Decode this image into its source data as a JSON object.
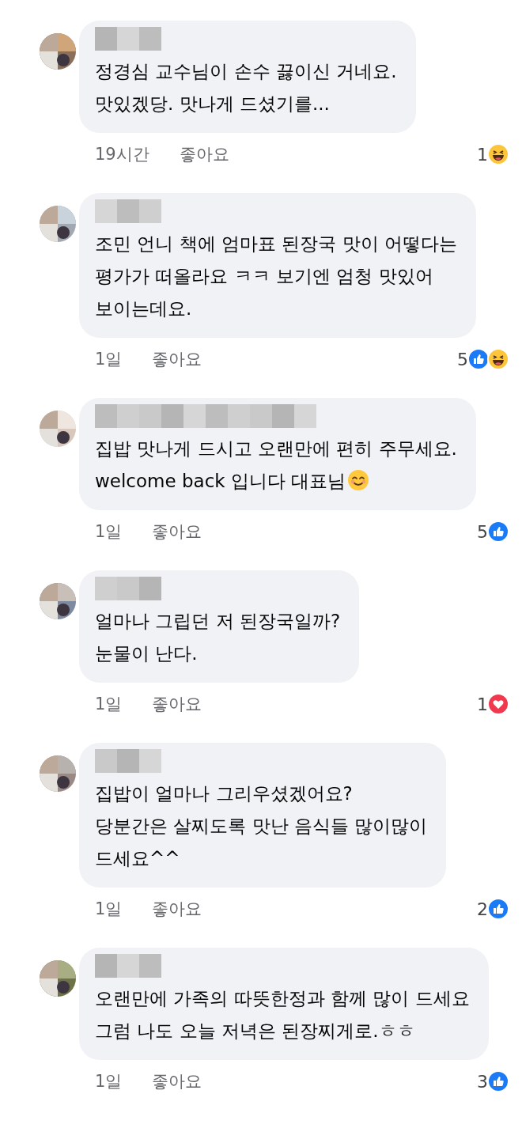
{
  "comments": [
    {
      "name_long": false,
      "text": "정경심 교수님이 손수 끓이신 거네요.\n맛있겠당. 맛나게 드셨기를...",
      "ends_with_emoji": false,
      "time": "19시간",
      "like_label": "좋아요",
      "reaction_count": "1",
      "reactions": [
        {
          "kind": "haha"
        }
      ]
    },
    {
      "name_long": false,
      "text": "조민 언니  책에  엄마표  된장국 맛이 어떻다는\n평가가 떠올라요 ㅋㅋ 보기엔  엄청 맛있어\n보이는데요.",
      "ends_with_emoji": false,
      "time": "1일",
      "like_label": "좋아요",
      "reaction_count": "5",
      "reactions": [
        {
          "kind": "like"
        },
        {
          "kind": "haha"
        }
      ]
    },
    {
      "name_long": true,
      "text": "집밥 맛나게 드시고 오랜만에 편히 주무세요.\nwelcome back 입니다 대표님",
      "ends_with_emoji": true,
      "time": "1일",
      "like_label": "좋아요",
      "reaction_count": "5",
      "reactions": [
        {
          "kind": "like"
        }
      ]
    },
    {
      "name_long": false,
      "text": "얼마나 그립던 저 된장국일까?\n눈물이 난다.",
      "ends_with_emoji": false,
      "time": "1일",
      "like_label": "좋아요",
      "reaction_count": "1",
      "reactions": [
        {
          "kind": "love"
        }
      ]
    },
    {
      "name_long": false,
      "text": "집밥이 얼마나 그리우셨겠어요?\n당분간은 살찌도록 맛난 음식들 많이많이\n드세요^^",
      "ends_with_emoji": false,
      "time": "1일",
      "like_label": "좋아요",
      "reaction_count": "2",
      "reactions": [
        {
          "kind": "like"
        }
      ]
    },
    {
      "name_long": false,
      "text": "오랜만에 가족의 따뜻한정과 함께 많이 드세요\n그럼 나도 오늘 저녁은 된장찌게로.ㅎㅎ",
      "ends_with_emoji": false,
      "time": "1일",
      "like_label": "좋아요",
      "reaction_count": "3",
      "reactions": [
        {
          "kind": "like"
        }
      ]
    }
  ]
}
